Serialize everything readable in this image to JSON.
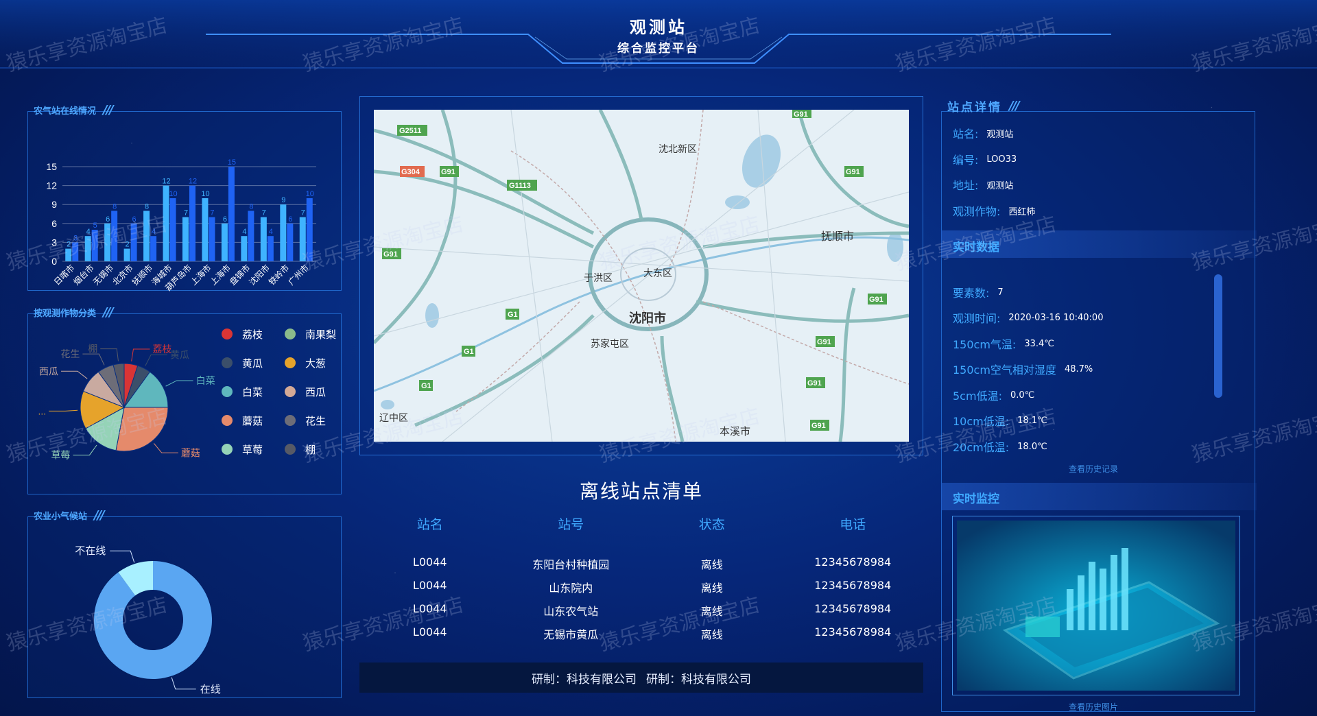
{
  "header": {
    "title": "观测站",
    "subtitle": "综合监控平台"
  },
  "panels": {
    "online": {
      "title": "农气站在线情况"
    },
    "crop": {
      "title": "按观测作物分类"
    },
    "micro": {
      "title": "农业小气候站"
    },
    "detail": {
      "title": "站点详情"
    }
  },
  "bar_chart": {
    "type": "bar",
    "categories": [
      "日喀市",
      "烟台市",
      "无锡市",
      "北京市",
      "抚顺市",
      "海城市",
      "葫芦岛市",
      "上海市",
      "上海市",
      "盘锦市",
      "沈阳市",
      "铁岭市",
      "广州市"
    ],
    "series": [
      {
        "values": [
          2,
          4,
          6,
          2,
          8,
          12,
          7,
          10,
          6,
          4,
          7,
          9,
          7
        ],
        "color": "#3fb3ff"
      },
      {
        "values": [
          3,
          5,
          8,
          6,
          4,
          10,
          12,
          7,
          15,
          8,
          4,
          6,
          10
        ],
        "color": "#1f63f4"
      }
    ],
    "yticks": [
      0,
      3,
      6,
      9,
      12,
      15
    ],
    "ylim": [
      0,
      15
    ]
  },
  "pie_chart": {
    "type": "pie",
    "slices": [
      {
        "label": "荔枝",
        "value": 5,
        "color": "#d93535"
      },
      {
        "label": "黄瓜",
        "value": 5,
        "color": "#3b4f6a"
      },
      {
        "label": "白菜",
        "value": 15,
        "color": "#5fb7bd"
      },
      {
        "label": "蘑菇",
        "value": 28,
        "color": "#e58a6b"
      },
      {
        "label": "草莓",
        "value": 14,
        "color": "#95d3b7"
      },
      {
        "label": "...",
        "value": 14,
        "color": "#e6a32b"
      },
      {
        "label": "西瓜",
        "value": 9,
        "color": "#c9aaa0"
      },
      {
        "label": "花生",
        "value": 6,
        "color": "#6d6d78"
      },
      {
        "label": "棚",
        "value": 4,
        "color": "#575a66"
      }
    ],
    "legend": [
      [
        "荔枝",
        "#d93535",
        "南果梨",
        "#8bbb8b"
      ],
      [
        "黄瓜",
        "#3b4f6a",
        "大葱",
        "#e6a32b"
      ],
      [
        "白菜",
        "#5fb7bd",
        "西瓜",
        "#d3a996"
      ],
      [
        "蘑菇",
        "#e58a6b",
        "花生",
        "#6d6d78"
      ],
      [
        "草莓",
        "#95d3b7",
        "棚",
        "#575a66"
      ]
    ]
  },
  "donut_chart": {
    "type": "pie",
    "slices": [
      {
        "label": "在线",
        "value": 90,
        "color": "#5aa6f2"
      },
      {
        "label": "不在线",
        "value": 10,
        "color": "#a8f0ff"
      }
    ]
  },
  "map": {
    "labels": [
      {
        "text": "沈北新区"
      },
      {
        "text": "抚顺市"
      },
      {
        "text": "大东区"
      },
      {
        "text": "于洪区"
      },
      {
        "text": "沈阳市"
      },
      {
        "text": "苏家屯区"
      },
      {
        "text": "辽中区"
      },
      {
        "text": "本溪市"
      }
    ],
    "shields": [
      "G2511",
      "G304",
      "G91",
      "G1113",
      "G91",
      "G91",
      "G91",
      "G1",
      "G1",
      "G1",
      "G91",
      "G91",
      "G91",
      "G91"
    ]
  },
  "offline_list": {
    "title": "离线站点清单",
    "columns": [
      "站名",
      "站号",
      "状态",
      "电话"
    ],
    "rows": [
      [
        "L0044",
        "东阳台村种植园",
        "离线",
        "12345678984"
      ],
      [
        "L0044",
        "山东院内",
        "离线",
        "12345678984"
      ],
      [
        "L0044",
        "山东农气站",
        "离线",
        "12345678984"
      ],
      [
        "L0044",
        "无锡市黄瓜",
        "离线",
        "12345678984"
      ]
    ]
  },
  "footer": {
    "text1": "研制：科技有限公司",
    "text2": "研制：科技有限公司"
  },
  "detail": {
    "rows": [
      {
        "label": "站名:",
        "value": "观测站"
      },
      {
        "label": "编号:",
        "value": "LOO33"
      },
      {
        "label": "地址:",
        "value": "观测站"
      },
      {
        "label": "观测作物:",
        "value": "西红柿"
      }
    ],
    "realtime_title": "实时数据",
    "realtime": [
      {
        "label": "要素数:",
        "value": "7"
      },
      {
        "label": "观测时间:",
        "value": "2020-03-16 10:40:00"
      },
      {
        "label": "150cm气温:",
        "value": "33.4℃"
      },
      {
        "label": "150cm空气相对湿度",
        "value": "48.7%"
      },
      {
        "label": "5cm低温:",
        "value": "0.0℃"
      },
      {
        "label": "10cm低温:",
        "value": "18.1℃"
      },
      {
        "label": "20cm低温:",
        "value": "18.0℃"
      }
    ],
    "history_link": "查看历史记录",
    "monitor_title": "实时监控",
    "photo_link": "查看历史图片"
  },
  "watermark": "猿乐享资源淘宝店"
}
